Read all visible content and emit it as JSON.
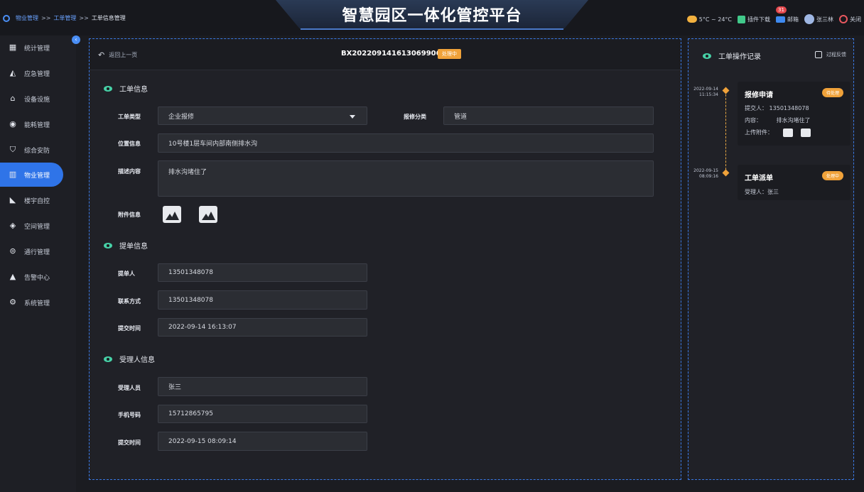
{
  "header": {
    "title": "智慧园区一体化管控平台",
    "breadcrumb": [
      "物业管理",
      ">>",
      "工单管理",
      ">>",
      "工单信息管理"
    ],
    "weather": "5°C ~ 24°C",
    "plugin_download": "插件下载",
    "mail_label": "邮箱",
    "mail_count": "31",
    "username": "张三林",
    "close_label": "关闭"
  },
  "sidebar": {
    "items": [
      {
        "label": "统计管理",
        "icon": "grid-icon"
      },
      {
        "label": "应急管理",
        "icon": "alarm-icon"
      },
      {
        "label": "设备设施",
        "icon": "device-icon"
      },
      {
        "label": "能耗管理",
        "icon": "energy-icon"
      },
      {
        "label": "综合安防",
        "icon": "shield-icon"
      },
      {
        "label": "物业管理",
        "icon": "building-icon"
      },
      {
        "label": "楼宇自控",
        "icon": "camera-icon"
      },
      {
        "label": "空间管理",
        "icon": "cube-icon"
      },
      {
        "label": "通行管理",
        "icon": "pass-icon"
      },
      {
        "label": "告警中心",
        "icon": "warning-icon"
      },
      {
        "label": "系统管理",
        "icon": "gear-icon"
      }
    ],
    "active_index": 5
  },
  "main": {
    "back_label": "返回上一页",
    "order_no": "BX2022091416130699069",
    "status": "处理中",
    "sections": {
      "order_info": "工单信息",
      "submit_info": "提单信息",
      "assignee_info": "受理人信息"
    },
    "fields": {
      "order_type_label": "工单类型",
      "order_type_value": "企业报修",
      "repair_category_label": "报修分类",
      "repair_category_value": "管道",
      "location_label": "位置信息",
      "location_value": "10号楼1层车间内部南侧排水沟",
      "description_label": "描述内容",
      "description_value": "排水沟堵住了",
      "attachment_label": "附件信息",
      "submitter_label": "提单人",
      "submitter_value": "13501348078",
      "contact_label": "联系方式",
      "contact_value": "13501348078",
      "submit_time_label": "提交时间",
      "submit_time_value": "2022-09-14  16:13:07",
      "assignee_label": "受理人员",
      "assignee_value": "张三",
      "phone_label": "手机号码",
      "phone_value": "15712865795",
      "assign_time_label": "提交时间",
      "assign_time_value": "2022-09-15  08:09:14"
    }
  },
  "right": {
    "title": "工单操作记录",
    "feedback_label": "过程反馈",
    "records": [
      {
        "date": "2022-09-14",
        "time": "11:15:34",
        "title": "报修申请",
        "badge": "待处理",
        "submitter_label": "提交人：",
        "submitter_value": "13501348078",
        "content_label": "内容：",
        "content_value": "排水沟堵住了",
        "attachment_label": "上传附件："
      },
      {
        "date": "2022-09-15",
        "time": "08:09:16",
        "title": "工单派单",
        "badge": "处理中",
        "assignee_text": "受理人：张三"
      }
    ]
  },
  "colors": {
    "accent": "#2f74e8",
    "status_orange": "#f0a23a",
    "teal": "#46d0a6"
  }
}
